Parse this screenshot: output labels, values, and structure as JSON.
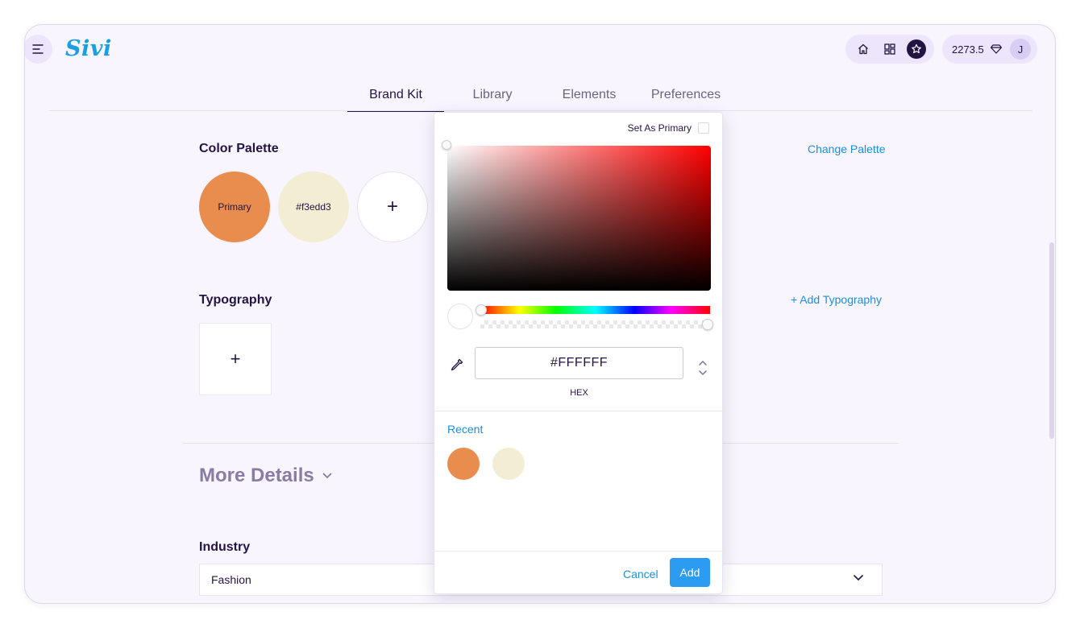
{
  "app": {
    "logo": "Sivi"
  },
  "header": {
    "credits": "2273.5",
    "avatar_initial": "J"
  },
  "tabs": [
    {
      "label": "Brand Kit",
      "active": true
    },
    {
      "label": "Library"
    },
    {
      "label": "Elements"
    },
    {
      "label": "Preferences"
    }
  ],
  "color_palette": {
    "title": "Color Palette",
    "action": "Change Palette",
    "swatches": [
      {
        "label": "Primary",
        "color": "#e88d4e"
      },
      {
        "label": "#f3edd3",
        "color": "#f3edd3"
      }
    ],
    "add_symbol": "+"
  },
  "typography": {
    "title": "Typography",
    "action": "+ Add Typography",
    "add_symbol": "+"
  },
  "more_details": {
    "title": "More Details"
  },
  "industry": {
    "label": "Industry",
    "value": "Fashion"
  },
  "color_picker": {
    "set_as_primary": "Set As Primary",
    "hex_value": "#FFFFFF",
    "format_label": "HEX",
    "recent_label": "Recent",
    "recent_colors": [
      "#e88d4e",
      "#f3edd3"
    ],
    "cancel_label": "Cancel",
    "add_label": "Add",
    "hue_color": "#ff0000",
    "alpha": 1.0
  },
  "colors": {
    "accent": "#1a8fe0",
    "primary_text": "#231444",
    "add_button": "#2b9cf2"
  }
}
